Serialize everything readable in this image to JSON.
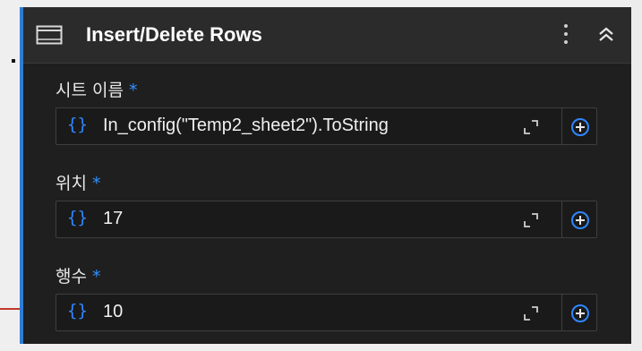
{
  "activity": {
    "title": "Insert/Delete Rows",
    "icon": "window-icon",
    "menu_icon": "kebab-icon",
    "collapse_icon": "chevron-double-up-icon"
  },
  "fields": [
    {
      "label": "시트 이름",
      "required": "*",
      "value": "In_config(\"Temp2_sheet2\").ToString"
    },
    {
      "label": "위치",
      "required": "*",
      "value": "17"
    },
    {
      "label": "행수",
      "required": "*",
      "value": "10"
    }
  ],
  "field_common": {
    "brace": "{}",
    "expand_icon": "expand-icon",
    "add_icon": "plus-circle-icon"
  },
  "colors": {
    "accent": "#2f7cd6",
    "required_star": "#2f8fff",
    "brace": "#2f86ff",
    "panel_bg": "#1f1f1f",
    "header_bg": "#2b2b2b"
  }
}
